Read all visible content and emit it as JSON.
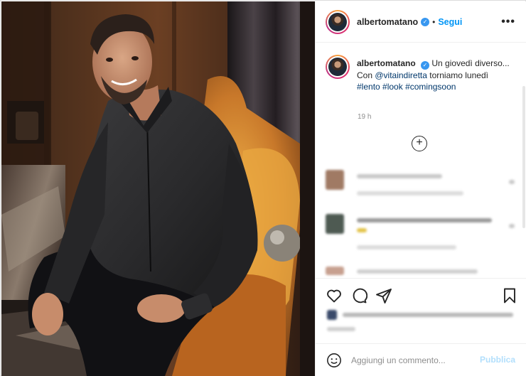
{
  "post": {
    "username": "albertomatano",
    "follow_label": "Segui",
    "more_label": "•••",
    "separator": "•"
  },
  "caption": {
    "username": "albertomatano",
    "text_1": "Un giovedì diverso...",
    "text_2_prefix": "Con ",
    "mention": "@vitaindiretta",
    "text_2_suffix": " torniamo lunedì",
    "tags": [
      "#lento",
      "#look",
      "#comingsoon"
    ],
    "time": "19 h"
  },
  "comment_box": {
    "placeholder": "Aggiungi un commento...",
    "publish_label": "Pubblica"
  },
  "colors": {
    "accent": "#0095f6",
    "link": "#00376b",
    "publish_disabled": "#b2dffc",
    "verified": "#3897f0"
  },
  "icons": [
    "heart-icon",
    "comment-icon",
    "share-icon",
    "bookmark-icon",
    "emoji-icon",
    "plus-circle-icon",
    "verified-icon",
    "more-icon"
  ]
}
